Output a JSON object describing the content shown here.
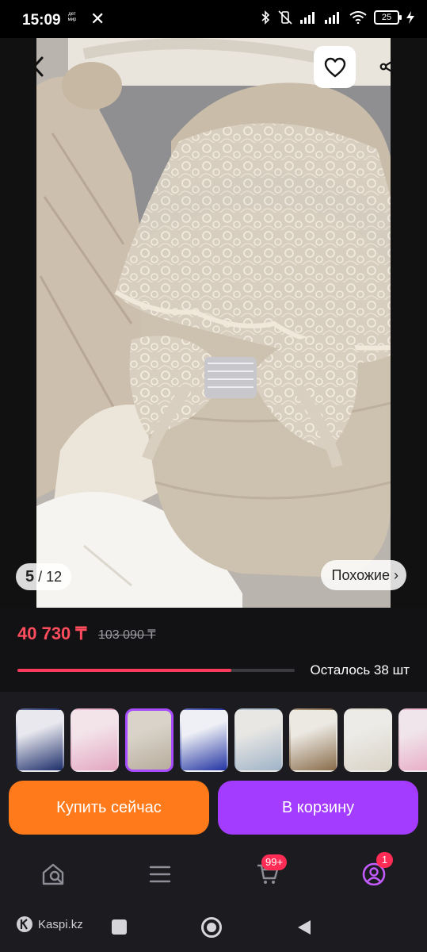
{
  "status_bar": {
    "time": "15:09",
    "app_badge_line1": "дет",
    "app_badge_line2": "мир",
    "battery": "25"
  },
  "gallery": {
    "current": "5",
    "total": "/ 12",
    "similar_label": "Похожие ›"
  },
  "product": {
    "price": "40 730 ₸",
    "old_price": "103 090 ₸",
    "stock_text": "Осталось 38 шт",
    "stock_fraction": 0.77
  },
  "thumbnails": [
    {
      "colors": [
        "#e8e8ee",
        "#1d2e6b"
      ],
      "active": false
    },
    {
      "colors": [
        "#f3e4ea",
        "#e3a6c0"
      ],
      "active": false
    },
    {
      "colors": [
        "#d9d3c9",
        "#b8ad9d"
      ],
      "active": true
    },
    {
      "colors": [
        "#eef0f5",
        "#2334a3"
      ],
      "active": false
    },
    {
      "colors": [
        "#e9e7e4",
        "#9fb3c7"
      ],
      "active": false
    },
    {
      "colors": [
        "#ece9e3",
        "#8a6d4b"
      ],
      "active": false
    },
    {
      "colors": [
        "#ecebe7",
        "#d9d3c6"
      ],
      "active": false
    },
    {
      "colors": [
        "#f0e5eb",
        "#e8a8c2"
      ],
      "active": false
    },
    {
      "colors": [
        "#eceff3",
        "#c7ced9"
      ],
      "active": false
    }
  ],
  "actions": {
    "buy_now": "Купить сейчас",
    "add_to_cart": "В корзину"
  },
  "bottom_nav": {
    "cart_badge": "99+",
    "profile_badge": "1"
  },
  "system_nav": {
    "brand": "Kaspi.kz"
  },
  "colors": {
    "accent_purple": "#a33cff",
    "accent_orange": "#ff7a1a",
    "price_red": "#ff4d5e"
  }
}
